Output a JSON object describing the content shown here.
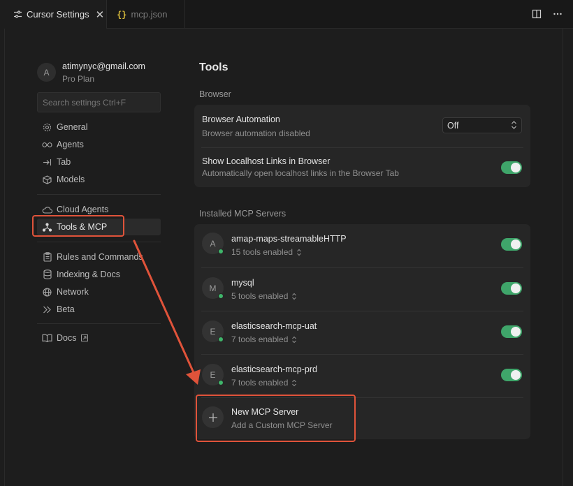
{
  "tabs": [
    {
      "label": "Cursor Settings",
      "icon": "settings-sliders-icon",
      "active": true
    },
    {
      "label": "mcp.json",
      "icon": "json-braces-icon",
      "active": false
    }
  ],
  "titlebar_actions": [
    "split-editor-icon",
    "more-icon"
  ],
  "profile": {
    "avatar_letter": "A",
    "email": "atimynyc@gmail.com",
    "plan": "Pro Plan"
  },
  "search": {
    "placeholder": "Search settings Ctrl+F"
  },
  "sidebar": {
    "group1": [
      {
        "label": "General",
        "icon": "gear-icon"
      },
      {
        "label": "Agents",
        "icon": "infinity-icon"
      },
      {
        "label": "Tab",
        "icon": "tab-arrow-icon"
      },
      {
        "label": "Models",
        "icon": "cube-icon"
      }
    ],
    "group2": [
      {
        "label": "Cloud Agents",
        "icon": "cloud-icon"
      },
      {
        "label": "Tools & MCP",
        "icon": "nodes-icon",
        "selected": true
      }
    ],
    "group3": [
      {
        "label": "Rules and Commands",
        "icon": "clipboard-icon"
      },
      {
        "label": "Indexing & Docs",
        "icon": "database-icon"
      },
      {
        "label": "Network",
        "icon": "globe-icon"
      },
      {
        "label": "Beta",
        "icon": "double-chevron-icon"
      }
    ],
    "group4": [
      {
        "label": "Docs",
        "icon": "book-icon",
        "external": true
      }
    ]
  },
  "main": {
    "title": "Tools",
    "browser_section": "Browser",
    "browser_rows": [
      {
        "title": "Browser Automation",
        "subtitle": "Browser automation disabled",
        "control": "select",
        "value": "Off"
      },
      {
        "title": "Show Localhost Links in Browser",
        "subtitle": "Automatically open localhost links in the Browser Tab",
        "control": "toggle",
        "on": true
      }
    ],
    "mcp_section": "Installed MCP Servers",
    "servers": [
      {
        "letter": "A",
        "name": "amap-maps-streamableHTTP",
        "tools": "15 tools enabled",
        "on": true
      },
      {
        "letter": "M",
        "name": "mysql",
        "tools": "5 tools enabled",
        "on": true
      },
      {
        "letter": "E",
        "name": "elasticsearch-mcp-uat",
        "tools": "7 tools enabled",
        "on": true
      },
      {
        "letter": "E",
        "name": "elasticsearch-mcp-prd",
        "tools": "7 tools enabled",
        "on": true
      }
    ],
    "new_server": {
      "title": "New MCP Server",
      "subtitle": "Add a Custom MCP Server",
      "icon": "plus-icon"
    }
  },
  "annotation_color": "#e0533a",
  "status_color": "#3fa56a"
}
